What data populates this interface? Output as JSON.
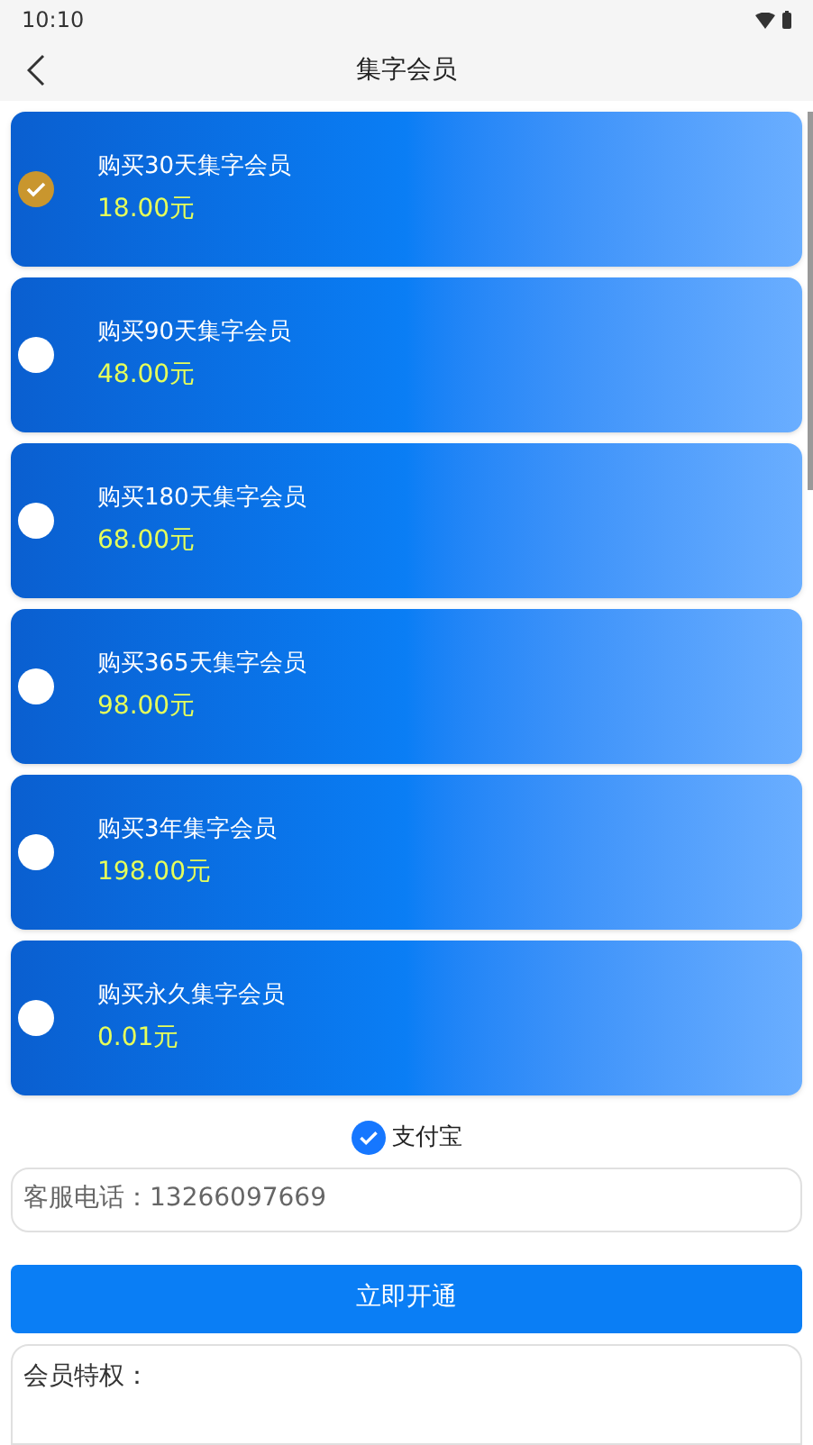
{
  "status_bar": {
    "time": "10:10"
  },
  "header": {
    "title": "集字会员"
  },
  "plans": [
    {
      "name": "购买30天集字会员",
      "price": "18.00元",
      "selected": true
    },
    {
      "name": "购买90天集字会员",
      "price": "48.00元",
      "selected": false
    },
    {
      "name": "购买180天集字会员",
      "price": "68.00元",
      "selected": false
    },
    {
      "name": "购买365天集字会员",
      "price": "98.00元",
      "selected": false
    },
    {
      "name": "购买3年集字会员",
      "price": "198.00元",
      "selected": false
    },
    {
      "name": "购买永久集字会员",
      "price": "0.01元",
      "selected": false
    }
  ],
  "payment": {
    "label": "支付宝",
    "checked": true
  },
  "service_phone": "客服电话：13266097669",
  "submit_button": "立即开通",
  "privileges": {
    "title": "会员特权："
  }
}
